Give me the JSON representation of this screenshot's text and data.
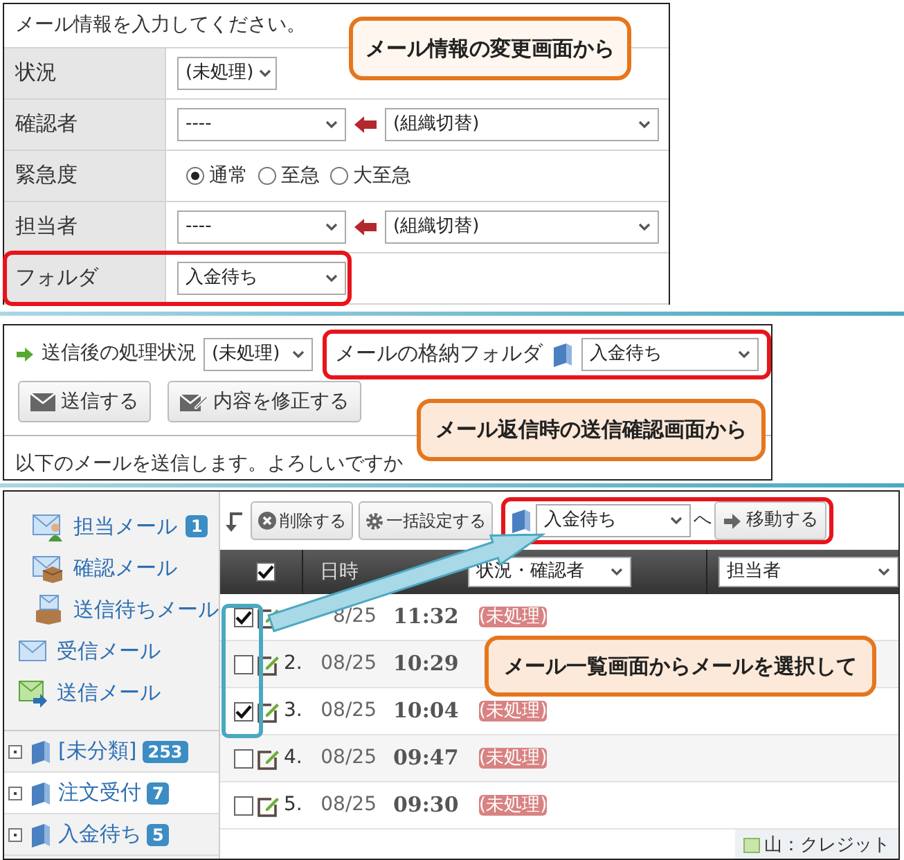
{
  "form_panel": {
    "instruction": "メール情報を入力してください。",
    "callout": "メール情報の変更画面から",
    "rows": [
      {
        "kind": "select",
        "label": "状況",
        "value": "(未処理)",
        "highlighted": false
      },
      {
        "kind": "select_pair",
        "label": "確認者",
        "value": "----",
        "org_value": "(組織切替)",
        "highlighted": false
      },
      {
        "kind": "radio",
        "label": "緊急度",
        "highlighted": false,
        "options": [
          {
            "label": "通常",
            "selected": true
          },
          {
            "label": "至急",
            "selected": false
          },
          {
            "label": "大至急",
            "selected": false
          }
        ]
      },
      {
        "kind": "select_pair",
        "label": "担当者",
        "value": "----",
        "org_value": "(組織切替)",
        "highlighted": false
      },
      {
        "kind": "select",
        "label": "フォルダ",
        "value": "入金待ち",
        "highlighted": true
      }
    ]
  },
  "confirm_panel": {
    "status_label": "送信後の処理状況",
    "status_value": "(未処理)",
    "folder_label": "メールの格納フォルダ",
    "folder_value": "入金待ち",
    "folder_highlighted": true,
    "buttons": [
      {
        "kind": "send",
        "label": "送信する"
      },
      {
        "kind": "edit",
        "label": "内容を修正する"
      }
    ],
    "message": "以下のメールを送信します。よろしいですか",
    "callout": "メール返信時の送信確認画面から"
  },
  "list_panel": {
    "sidebar": {
      "items": [
        {
          "kind": "assigned",
          "label": "担当メール",
          "count": "1"
        },
        {
          "kind": "confirm",
          "label": "確認メール"
        },
        {
          "kind": "pending",
          "label": "送信待ちメール"
        },
        {
          "kind": "inbox",
          "label": "受信メール"
        },
        {
          "kind": "sent",
          "label": "送信メール"
        }
      ],
      "folders": [
        {
          "label": "[未分類]",
          "count": "253",
          "selected": false
        },
        {
          "label": "注文受付",
          "count": "7",
          "selected": true
        },
        {
          "label": "入金待ち",
          "count": "5",
          "selected": false
        }
      ]
    },
    "toolbar": {
      "buttons": [
        {
          "kind": "delete",
          "label": "削除する"
        },
        {
          "kind": "bulk",
          "label": "一括設定する"
        }
      ],
      "folder_value": "入金待ち",
      "to_label": "へ",
      "move_button": "移動する",
      "move_highlighted": true
    },
    "columns": {
      "header_checked": true,
      "date": "日時",
      "status_filter": "状況・確認者",
      "assignee_filter": "担当者"
    },
    "rows": [
      {
        "checked": true,
        "date": "8/25",
        "time": "11:32",
        "status": "(未処理)"
      },
      {
        "checked": false,
        "number": "2.",
        "date": "08/25",
        "time": "10:29"
      },
      {
        "checked": true,
        "number": "3.",
        "date": "08/25",
        "time": "10:04",
        "status": "(未処理)"
      },
      {
        "checked": false,
        "number": "4.",
        "date": "08/25",
        "time": "09:47",
        "status": "(未処理)"
      },
      {
        "checked": false,
        "number": "5.",
        "date": "08/25",
        "time": "09:30",
        "status": "(未処理)"
      }
    ],
    "checkbox_highlight": true,
    "legend": "山：クレジット",
    "callout": "メール一覧画面からメールを選択して"
  }
}
